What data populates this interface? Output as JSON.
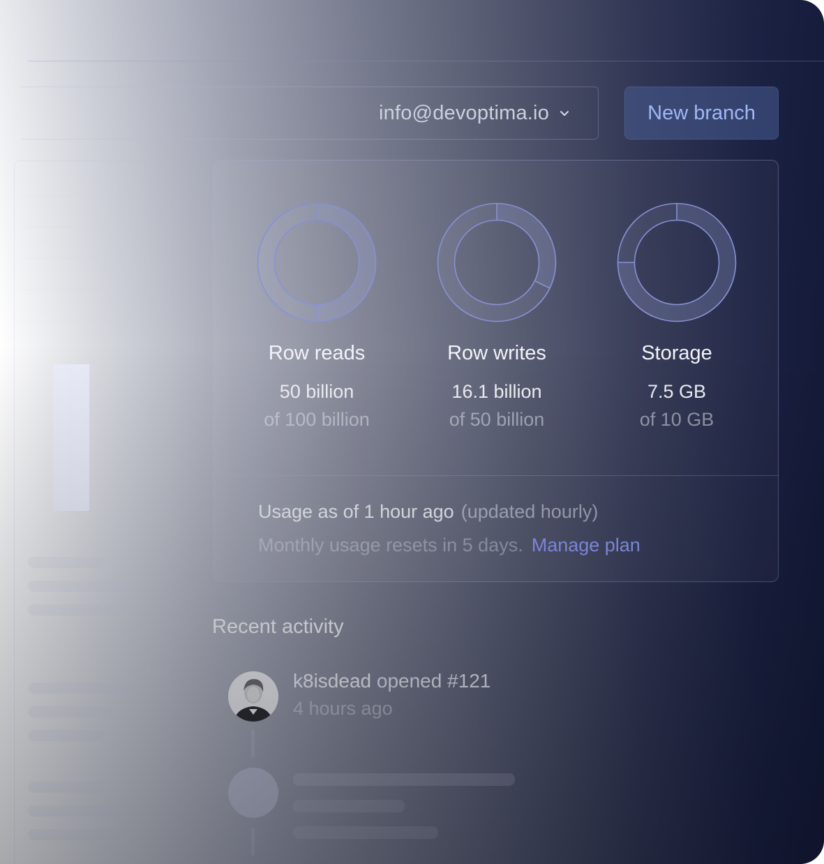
{
  "header": {
    "account_email": "info@devoptima.io",
    "new_branch_label": "New branch"
  },
  "usage": {
    "metrics": [
      {
        "label": "Row reads",
        "value": "50 billion",
        "limit": "of 100 billion",
        "fraction": 0.5
      },
      {
        "label": "Row writes",
        "value": "16.1 billion",
        "limit": "of 50 billion",
        "fraction": 0.322
      },
      {
        "label": "Storage",
        "value": "7.5 GB",
        "limit": "of 10 GB",
        "fraction": 0.75
      }
    ],
    "as_of": "Usage as of 1 hour ago",
    "update_note": "(updated hourly)",
    "reset_text": "Monthly usage resets in 5 days.",
    "manage_plan_link": "Manage plan"
  },
  "activity": {
    "title": "Recent activity",
    "items": [
      {
        "user": "k8isdead",
        "action": "opened #121",
        "time": "4 hours ago",
        "avatar_icon": "user-photo-avatar"
      }
    ]
  },
  "colors": {
    "accent": "#8e98f4",
    "button_text": "#a9c1ff",
    "ring": "#8a94d8"
  }
}
